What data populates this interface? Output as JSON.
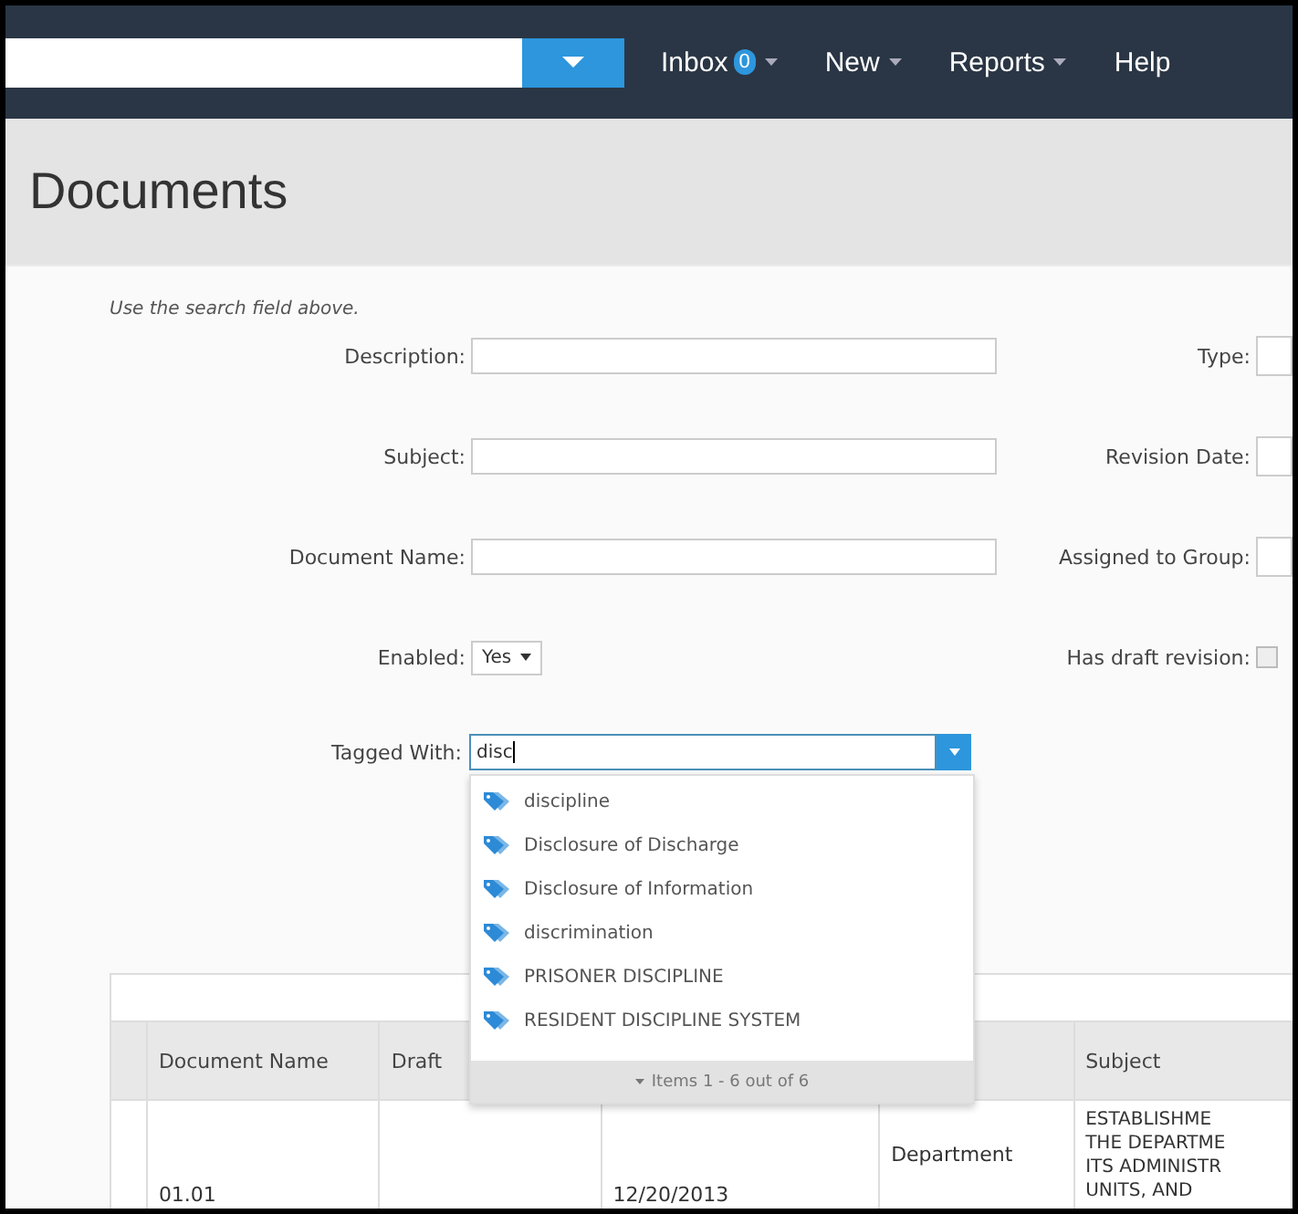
{
  "nav": {
    "items": [
      {
        "label": "Inbox",
        "badge": "0"
      },
      {
        "label": "New"
      },
      {
        "label": "Reports"
      },
      {
        "label": "Help",
        "caret": false
      }
    ]
  },
  "page_title": "Documents",
  "hint": "Use the search field above.",
  "form_left": [
    {
      "label": "Description:",
      "kind": "text"
    },
    {
      "label": "Subject:",
      "kind": "text"
    },
    {
      "label": "Document Name:",
      "kind": "text"
    },
    {
      "label": "Enabled:",
      "kind": "select",
      "value": "Yes"
    }
  ],
  "form_right": [
    {
      "label": "Type:",
      "kind": "field"
    },
    {
      "label": "Revision Date:",
      "kind": "field"
    },
    {
      "label": "Assigned to Group:",
      "kind": "field"
    },
    {
      "label": "Has draft revision:",
      "kind": "checkbox",
      "checked": false
    }
  ],
  "tagged_with": {
    "label": "Tagged With:",
    "value": "disc"
  },
  "suggestions": {
    "items": [
      "discipline",
      "Disclosure of Discharge",
      "Disclosure of Information",
      "discrimination",
      "PRISONER DISCIPLINE",
      "RESIDENT DISCIPLINE SYSTEM"
    ],
    "footer": "Items 1 - 6 out of 6"
  },
  "table": {
    "columns": [
      {},
      {
        "label": "Document Name"
      },
      {
        "label": "Draft"
      },
      {},
      {},
      {
        "label": "Subject"
      }
    ],
    "rows": [
      {
        "cells": [
          {},
          {
            "text": "01.01"
          },
          {},
          {
            "text": "12/20/2013"
          },
          {
            "text": "Department"
          },
          {
            "lines": [
              "ESTABLISHME",
              "THE DEPARTME",
              "ITS ADMINISTR",
              "UNITS, AND"
            ]
          }
        ]
      }
    ]
  }
}
